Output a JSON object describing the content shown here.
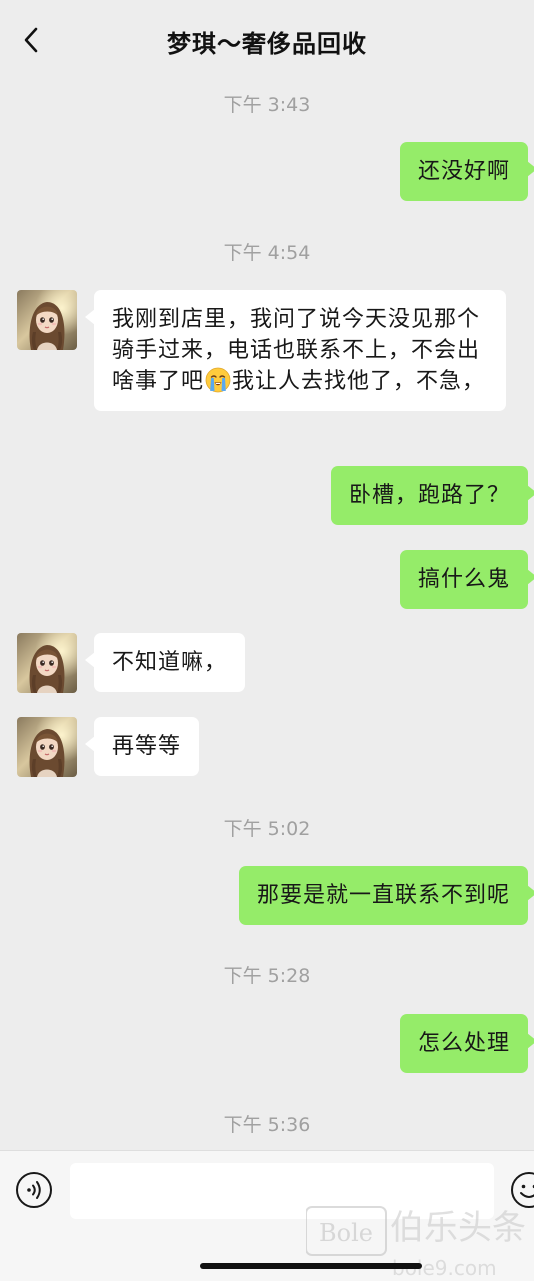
{
  "header": {
    "title": "梦琪～奢侈品回收",
    "back_icon": "chevron-left-icon"
  },
  "messages": [
    {
      "type": "time",
      "text": "下午 3:43"
    },
    {
      "type": "msg",
      "side": "right",
      "text": "还没好啊"
    },
    {
      "type": "time",
      "text": "下午 4:54"
    },
    {
      "type": "msg",
      "side": "left",
      "text_before_emoji": "我刚到店里，我问了说今天没见那个骑手过来，电话也联系不上，不会出啥事了吧",
      "emoji": "crying-face-emoji",
      "text_after_emoji": "我让人去找他了，不急，"
    },
    {
      "type": "msg",
      "side": "right",
      "text": "卧槽，跑路了？"
    },
    {
      "type": "msg",
      "side": "right",
      "text": "搞什么鬼"
    },
    {
      "type": "msg",
      "side": "left",
      "text": "不知道嘛，"
    },
    {
      "type": "msg",
      "side": "left",
      "text": "再等等"
    },
    {
      "type": "time",
      "text": "下午 5:02"
    },
    {
      "type": "msg",
      "side": "right",
      "text": "那要是就一直联系不到呢"
    },
    {
      "type": "time",
      "text": "下午 5:28"
    },
    {
      "type": "msg",
      "side": "right",
      "text": "怎么处理"
    },
    {
      "type": "time",
      "text": "下午 5:36"
    }
  ],
  "input_bar": {
    "voice_icon": "voice-icon",
    "input_value": "",
    "emoji_icon": "emoji-icon"
  },
  "watermark": {
    "logo_text": "Bole",
    "cn_text": "伯乐头条",
    "url": "bole9.com"
  },
  "colors": {
    "background": "#ededed",
    "bubble_sent": "#95ec69",
    "bubble_received": "#ffffff",
    "timestamp": "#a0a0a0"
  }
}
